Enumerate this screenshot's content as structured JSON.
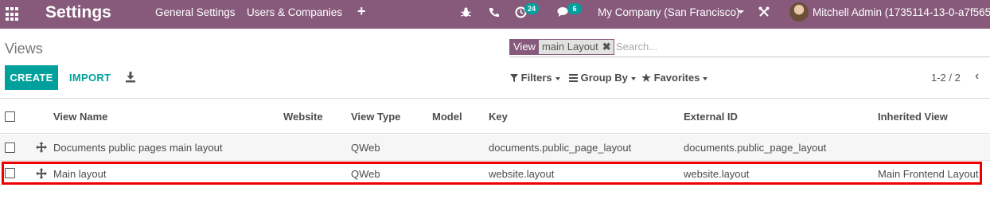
{
  "navbar": {
    "app_title": "Settings",
    "menu": [
      "General Settings",
      "Users & Companies"
    ],
    "add_label": "+",
    "activity_badge": "24",
    "messages_badge": "6",
    "company": "My Company (San Francisco)",
    "user": "Mitchell Admin (1735114-13-0-a7f565-"
  },
  "breadcrumb": "Views",
  "search": {
    "facet_label": "View",
    "facet_value": "main Layout",
    "facet_remove": "✖",
    "placeholder": "Search..."
  },
  "buttons": {
    "create": "CREATE",
    "import": "IMPORT"
  },
  "filters": {
    "filters_label": "Filters",
    "groupby_label": "Group By",
    "favorites_label": "Favorites"
  },
  "pager": {
    "value": "1-2 / 2"
  },
  "table": {
    "columns": [
      "View Name",
      "Website",
      "View Type",
      "Model",
      "Key",
      "External ID",
      "Inherited View"
    ],
    "rows": [
      {
        "name": "Documents public pages main layout",
        "website": "",
        "type": "QWeb",
        "model": "",
        "key": "documents.public_page_layout",
        "external_id": "documents.public_page_layout",
        "inherited": ""
      },
      {
        "name": "Main layout",
        "website": "",
        "type": "QWeb",
        "model": "",
        "key": "website.layout",
        "external_id": "website.layout",
        "inherited": "Main Frontend Layout"
      }
    ]
  },
  "colors": {
    "navbar": "#875a7b",
    "accent": "#00a09d",
    "highlight": "#e00000"
  },
  "icons": {
    "apps": "apps-grid-icon",
    "bug": "bug-icon",
    "phone": "phone-icon",
    "activity": "clock-icon",
    "messages": "chat-icon",
    "tools": "wrench-icon",
    "download": "download-icon",
    "drag": "drag-handle-icon"
  }
}
